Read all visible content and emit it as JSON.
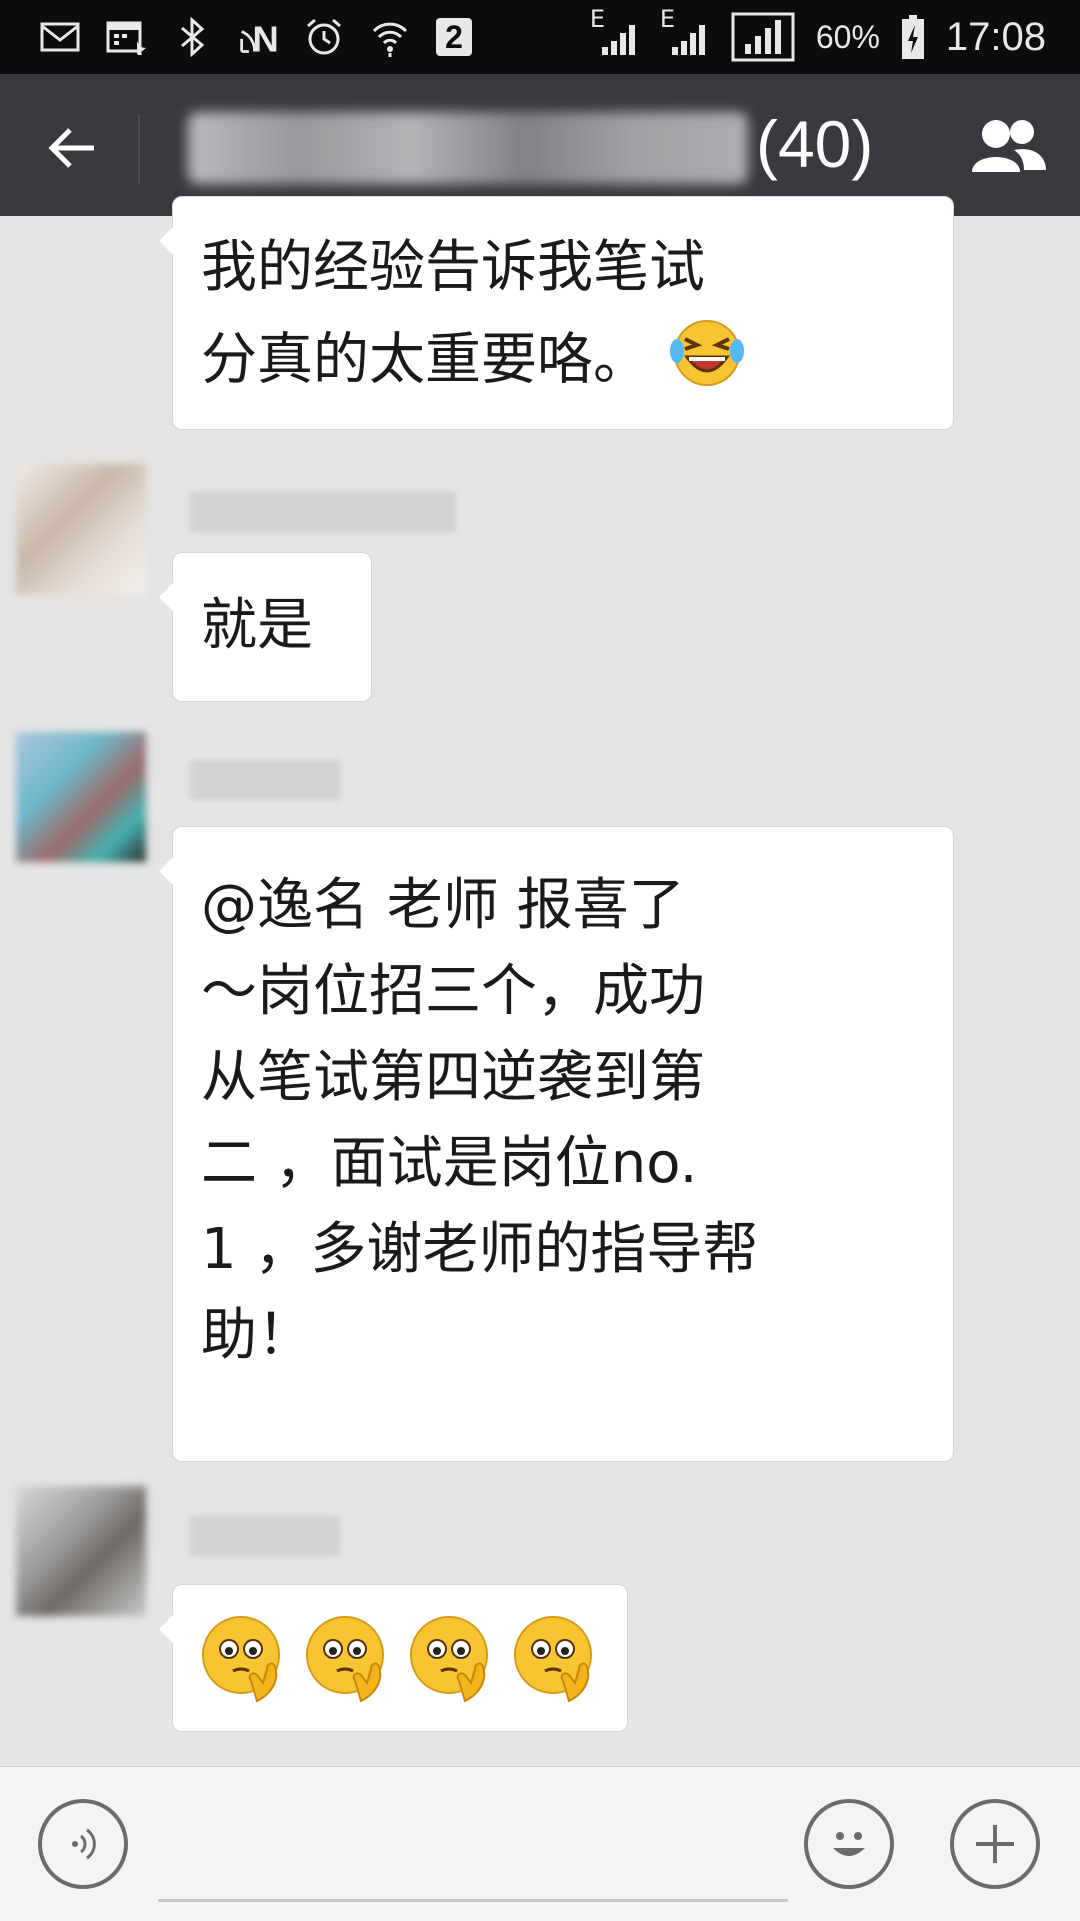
{
  "status_bar": {
    "icons": [
      "mail-icon",
      "calendar-icon",
      "bluetooth-icon",
      "nfc-icon",
      "alarm-icon",
      "wifi-icon",
      "notification-2-icon",
      "signal-e-icon",
      "signal-e-icon"
    ],
    "notification_badge": "2",
    "network_label_1": "E",
    "network_label_2": "E",
    "battery": "60%",
    "time": "17:08"
  },
  "header": {
    "member_count": "(40)"
  },
  "messages": [
    {
      "lines": [
        "我的经验告诉我笔试",
        "分真的太重要咯。"
      ],
      "emoji": "laughing-tears-emoji"
    },
    {
      "lines": [
        "就是"
      ]
    },
    {
      "lines": [
        "@逸名 老师 报喜了",
        "～岗位招三个，成功",
        "从笔试第四逆袭到第",
        "二 ，面试是岗位no.",
        "1 ，多谢老师的指导帮",
        "助！"
      ]
    },
    {
      "emoji_repeat": 4,
      "emoji": "thinking-face-emoji"
    }
  ],
  "colors": {
    "title_bar": "#393a3f",
    "status_bar": "#0c0c0c",
    "chat_bg": "#e5e5e5",
    "bubble": "#ffffff"
  }
}
